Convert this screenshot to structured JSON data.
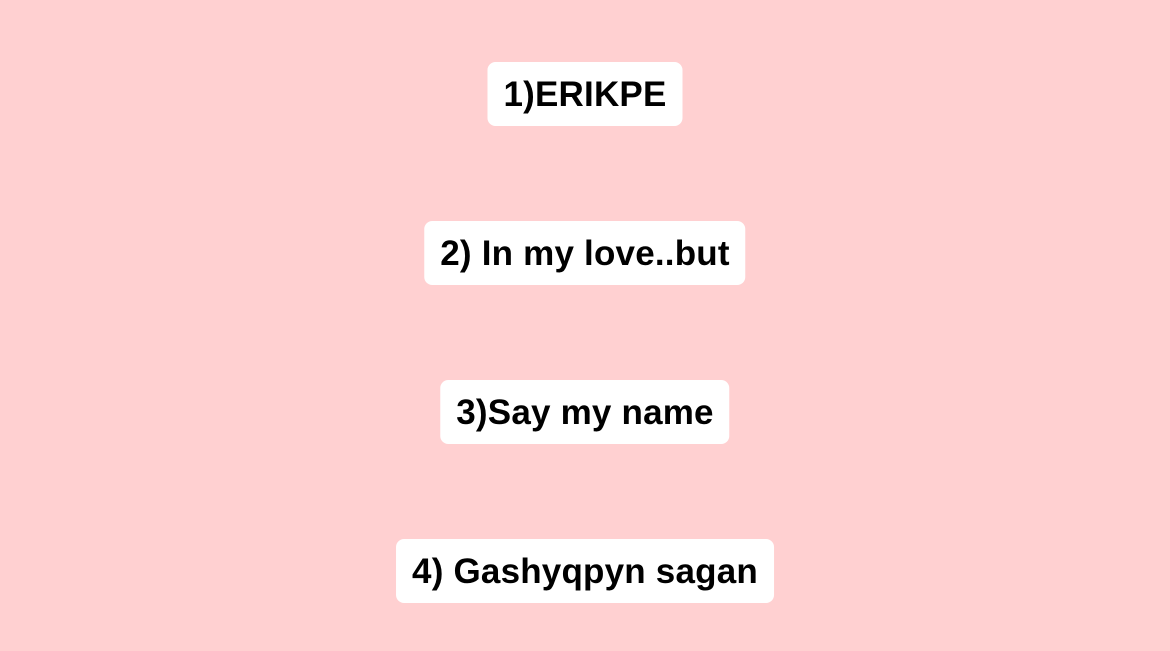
{
  "background_color": "#ffd0d1",
  "label_background_color": "#ffffff",
  "text_color": "#000000",
  "items": [
    {
      "label": "1)ERIKPE"
    },
    {
      "label": "2) In my love..but"
    },
    {
      "label": "3)Say my name"
    },
    {
      "label": "4) Gashyqpyn sagan "
    }
  ]
}
